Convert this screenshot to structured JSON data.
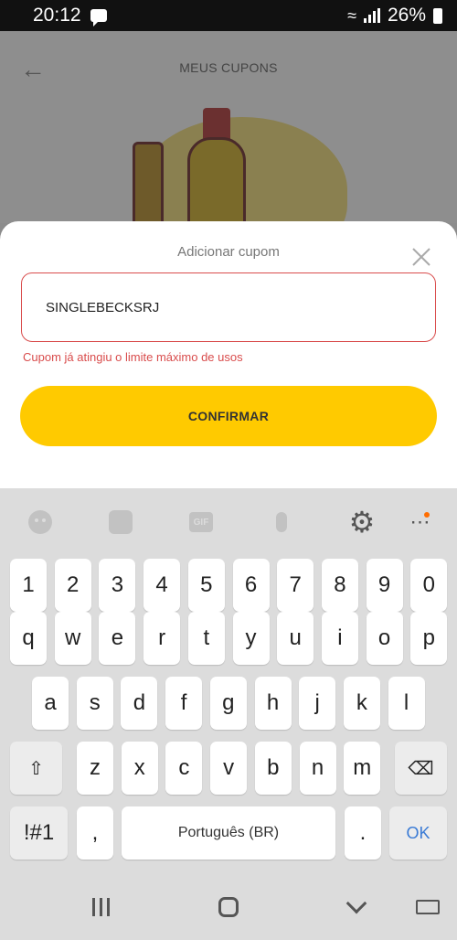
{
  "status_bar": {
    "time": "20:12",
    "battery": "26%"
  },
  "app": {
    "title": "MEUS CUPONS"
  },
  "dialog": {
    "title": "Adicionar cupom",
    "coupon_value": "SINGLEBECKSRJ",
    "error_message": "Cupom já atingiu o limite máximo de usos",
    "confirm_label": "CONFIRMAR"
  },
  "keyboard": {
    "toolbar_icons": [
      "emoji-icon",
      "sticker-icon",
      "gif-icon",
      "microphone-icon",
      "gear-icon",
      "more-icon"
    ],
    "gif_label": "GIF",
    "rows": [
      [
        "1",
        "2",
        "3",
        "4",
        "5",
        "6",
        "7",
        "8",
        "9",
        "0"
      ],
      [
        "q",
        "w",
        "e",
        "r",
        "t",
        "y",
        "u",
        "i",
        "o",
        "p"
      ],
      [
        "a",
        "s",
        "d",
        "f",
        "g",
        "h",
        "j",
        "k",
        "l"
      ],
      [
        "z",
        "x",
        "c",
        "v",
        "b",
        "n",
        "m"
      ]
    ],
    "symbols_label": "!#1",
    "comma": ",",
    "space_label": "Português (BR)",
    "period": ".",
    "ok_label": "OK"
  },
  "nav_bar": {
    "icons": [
      "recents-icon",
      "home-icon",
      "back-icon",
      "keyboard-icon"
    ]
  }
}
